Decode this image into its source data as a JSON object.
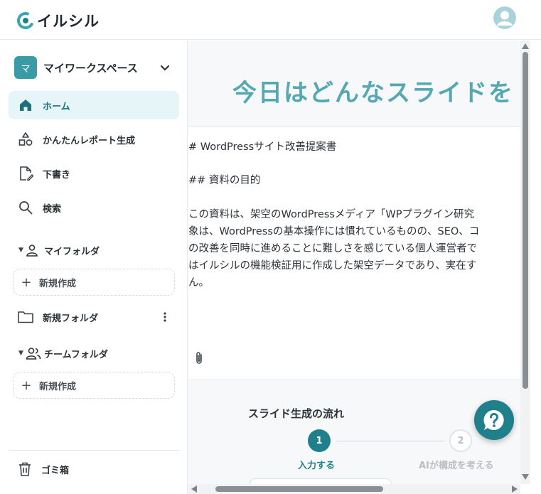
{
  "header": {
    "logo_text": "イルシル"
  },
  "sidebar": {
    "workspace": {
      "badge": "マ",
      "name": "マイワークスペース"
    },
    "nav": [
      {
        "label": "ホーム",
        "icon": "home-icon",
        "active": true
      },
      {
        "label": "かんたんレポート生成",
        "icon": "shapes-icon",
        "active": false
      },
      {
        "label": "下書き",
        "icon": "draft-icon",
        "active": false
      },
      {
        "label": "検索",
        "icon": "search-icon",
        "active": false
      }
    ],
    "my_folder": {
      "label": "マイフォルダ",
      "new_label": "新規作成"
    },
    "folder": {
      "label": "新規フォルダ"
    },
    "team_folder": {
      "label": "チームフォルダ",
      "new_label": "新規作成"
    },
    "trash": {
      "label": "ゴミ箱"
    }
  },
  "main": {
    "hero": "今日はどんなスライドを",
    "editor_lines": [
      "# WordPressサイト改善提案書",
      "## 資料の目的",
      "この資料は、架空のWordPressメディア「WPプラグイン研究",
      "象は、WordPressの基本操作には慣れているものの、SEO、コ",
      "の改善を同時に進めることに難しさを感じている個人運営者で",
      "はイルシルの機能検証用に作成した架空データであり、実在す",
      "ん。"
    ],
    "flow": {
      "title": "スライド生成の流れ",
      "steps": [
        {
          "number": "1",
          "label": "入力する"
        },
        {
          "number": "2",
          "label": "AIが構成を考える"
        }
      ]
    }
  },
  "colors": {
    "accent": "#1f7f8b",
    "hero": "#54a8b3",
    "active_bg": "#e6f5f7"
  }
}
